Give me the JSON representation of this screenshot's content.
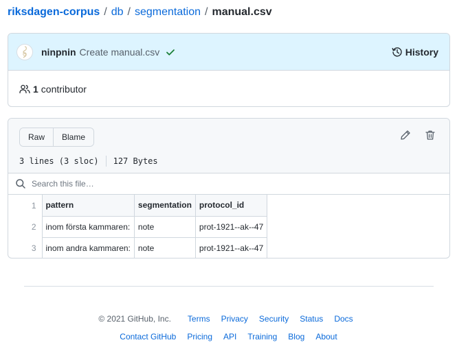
{
  "breadcrumb": {
    "repo": "riksdagen-corpus",
    "path": [
      "db",
      "segmentation"
    ],
    "file": "manual.csv",
    "separator": "/"
  },
  "commit": {
    "author": "ninpnin",
    "message": "Create manual.csv",
    "status_icon": "check-icon",
    "status_color": "#1a7f37",
    "history_label": "History"
  },
  "contributors": {
    "count": "1",
    "label": "contributor"
  },
  "file": {
    "buttons": {
      "raw": "Raw",
      "blame": "Blame"
    },
    "lines_info": "3 lines (3 sloc)",
    "size": "127 Bytes",
    "search_placeholder": "Search this file…"
  },
  "table": {
    "headers": [
      "pattern",
      "segmentation",
      "protocol_id"
    ],
    "rows": [
      [
        "inom första kammaren:",
        "note",
        "prot-1921--ak--47"
      ],
      [
        "inom andra kammaren:",
        "note",
        "prot-1921--ak--47"
      ]
    ],
    "line_numbers": [
      "1",
      "2",
      "3"
    ]
  },
  "footer": {
    "copyright": "© 2021 GitHub, Inc.",
    "row1_links": [
      "Terms",
      "Privacy",
      "Security",
      "Status",
      "Docs"
    ],
    "row2_links": [
      "Contact GitHub",
      "Pricing",
      "API",
      "Training",
      "Blog",
      "About"
    ]
  },
  "colors": {
    "link": "#0969da",
    "header_bg": "#ddf4ff",
    "border": "#d0d7de"
  }
}
